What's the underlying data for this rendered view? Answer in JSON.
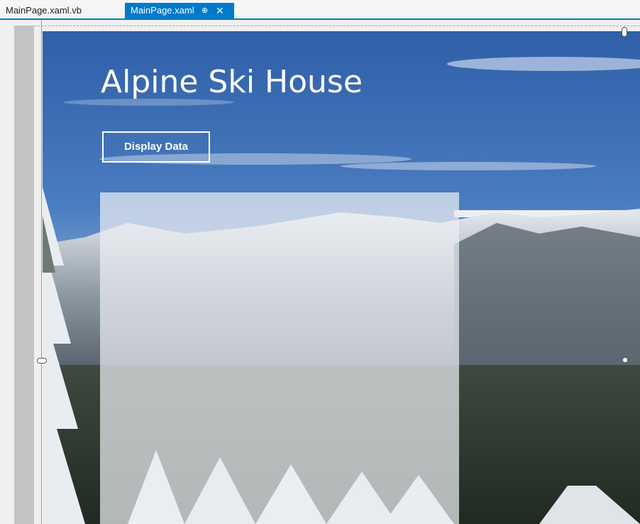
{
  "tabs": [
    {
      "label": "MainPage.xaml.vb",
      "active": false
    },
    {
      "label": "MainPage.xaml",
      "active": true,
      "pin_glyph": "⊕",
      "close_glyph": "✕"
    }
  ],
  "app": {
    "title": "Alpine Ski House",
    "button_label": "Display Data"
  },
  "colors": {
    "accent": "#007acc",
    "sky": "#3d6db4",
    "panel": "#eceef2"
  },
  "icons": [
    "pin-icon",
    "close-icon",
    "resize-handle-icon"
  ]
}
